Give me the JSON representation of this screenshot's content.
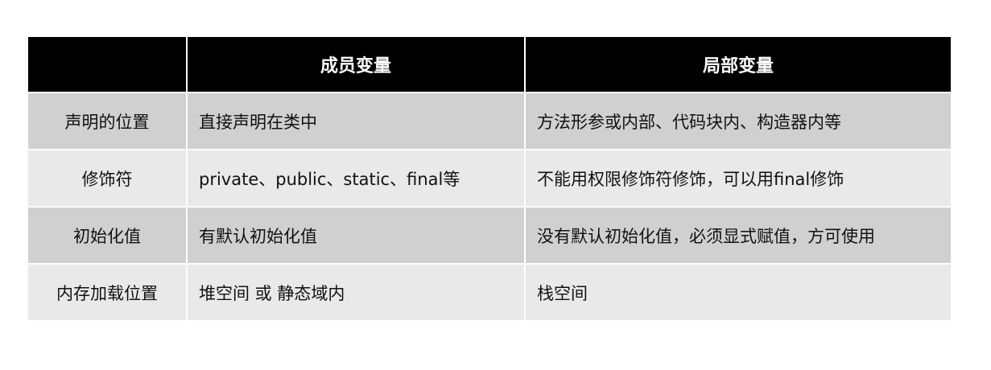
{
  "table": {
    "headers": [
      "",
      "成员变量",
      "局部变量"
    ],
    "rows": [
      [
        "声明的位置",
        "直接声明在类中",
        "方法形参或内部、代码块内、构造器内等"
      ],
      [
        "修饰符",
        "private、public、static、final等",
        "不能用权限修饰符修饰，可以用final修饰"
      ],
      [
        "初始化值",
        "有默认初始化值",
        "没有默认初始化值，必须显式赋值，方可使用"
      ],
      [
        "内存加载位置",
        "堆空间 或 静态域内",
        "栈空间"
      ]
    ]
  }
}
